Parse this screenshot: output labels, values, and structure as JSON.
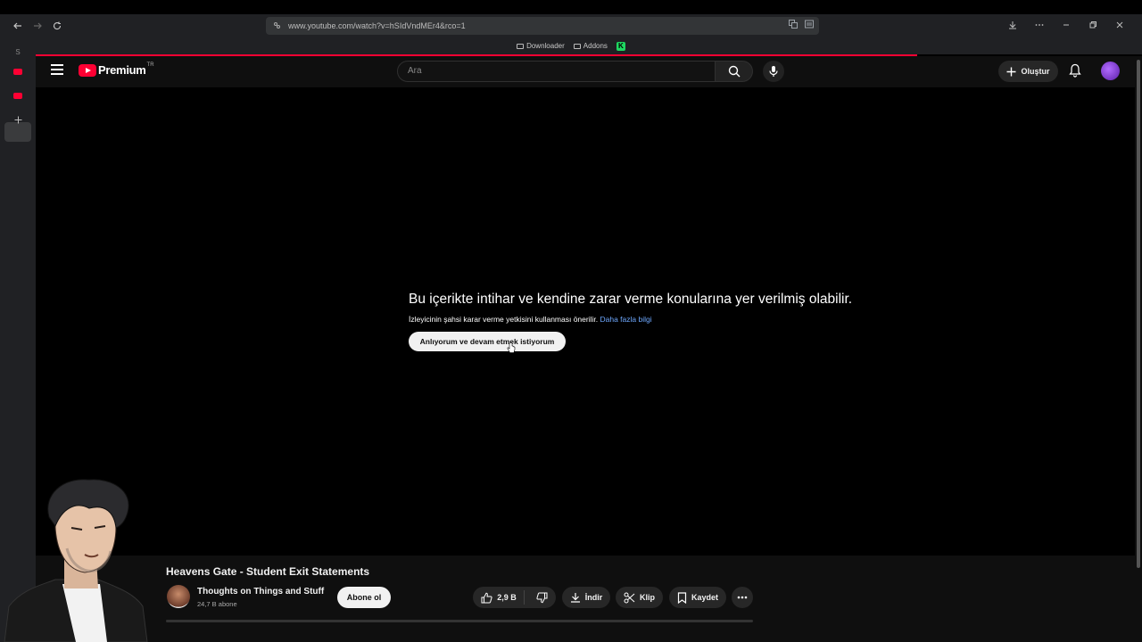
{
  "browser": {
    "url": "www.youtube.com/watch?v=hSIdVndMEr4&rco=1",
    "bookmarks": [
      {
        "label": "Downloader"
      },
      {
        "label": "Addons"
      }
    ],
    "bookmark_k": "K"
  },
  "sidebar": {
    "s_label": "S"
  },
  "header": {
    "logo_text": "Premium",
    "logo_region": "TR",
    "search_placeholder": "Ara",
    "create_label": "Oluştur"
  },
  "warning": {
    "title": "Bu içerikte intihar ve kendine zarar verme konularına yer verilmiş olabilir.",
    "subtitle": "İzleyicinin şahsi karar verme yetkisini kullanması önerilir.",
    "link": "Daha fazla bilgi",
    "accept_label": "Anlıyorum ve devam etmek istiyorum"
  },
  "video": {
    "title": "Heavens Gate - Student Exit Statements",
    "channel_name": "Thoughts on Things and Stuff",
    "subscribers": "24,7 B abone",
    "subscribe_label": "Abone ol",
    "likes": "2,9 B",
    "download_label": "İndir",
    "clip_label": "Klip",
    "save_label": "Kaydet"
  },
  "colors": {
    "accent": "#ff0033",
    "link": "#6ea8fe",
    "background": "#0f0f0f"
  }
}
